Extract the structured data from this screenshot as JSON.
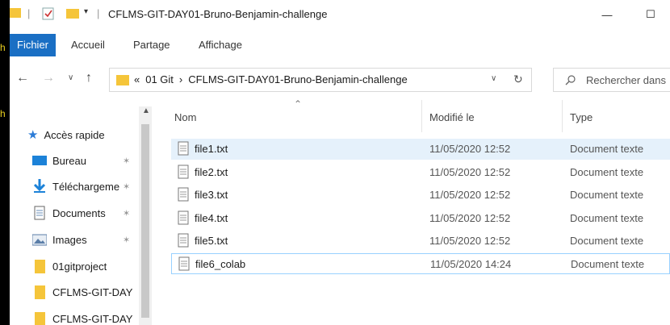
{
  "window": {
    "title": "CFLMS-GIT-DAY01-Bruno-Benjamin-challenge",
    "minimize_glyph": "—",
    "maximize_glyph": "☐"
  },
  "ribbon": {
    "tabs": [
      "Fichier",
      "Accueil",
      "Partage",
      "Affichage"
    ]
  },
  "address": {
    "prefix": "«",
    "crumbs": [
      "01 Git",
      "CFLMS-GIT-DAY01-Bruno-Benjamin-challenge"
    ],
    "separator": "›"
  },
  "search": {
    "placeholder": "Rechercher dans"
  },
  "nav": {
    "items": [
      {
        "label": "Accès rapide",
        "icon": "star-icon",
        "pinned": false
      },
      {
        "label": "Bureau",
        "icon": "desktop-icon",
        "pinned": true
      },
      {
        "label": "Téléchargeme",
        "icon": "download-icon",
        "pinned": true
      },
      {
        "label": "Documents",
        "icon": "documents-icon",
        "pinned": true
      },
      {
        "label": "Images",
        "icon": "images-icon",
        "pinned": true
      },
      {
        "label": "01gitproject",
        "icon": "folder-icon",
        "pinned": false
      },
      {
        "label": "CFLMS-GIT-DAY",
        "icon": "folder-icon",
        "pinned": false
      },
      {
        "label": "CFLMS-GIT-DAY",
        "icon": "folder-icon",
        "pinned": false
      }
    ]
  },
  "columns": {
    "name": "Nom",
    "modified": "Modifié le",
    "type": "Type"
  },
  "files": [
    {
      "name": "file1.txt",
      "modified": "11/05/2020 12:52",
      "type": "Document texte"
    },
    {
      "name": "file2.txt",
      "modified": "11/05/2020 12:52",
      "type": "Document texte"
    },
    {
      "name": "file3.txt",
      "modified": "11/05/2020 12:52",
      "type": "Document texte"
    },
    {
      "name": "file4.txt",
      "modified": "11/05/2020 12:52",
      "type": "Document texte"
    },
    {
      "name": "file5.txt",
      "modified": "11/05/2020 12:52",
      "type": "Document texte"
    },
    {
      "name": "file6_colab",
      "modified": "11/05/2020 14:24",
      "type": "Document texte"
    }
  ],
  "colors": {
    "accent": "#1a6fc4",
    "folder": "#f5c53a",
    "selection": "#e5f1fb"
  }
}
